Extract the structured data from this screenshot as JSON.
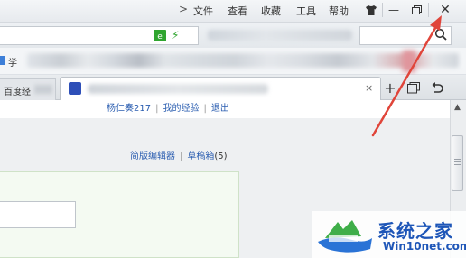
{
  "menubar": {
    "items": [
      "文件",
      "查看",
      "收藏",
      "工具",
      "帮助"
    ],
    "overflow_arrow": ">"
  },
  "window_controls": {
    "skin": "skin-icon",
    "minimize": "—",
    "restore": "restore-icon",
    "close": "✕"
  },
  "address_bar": {
    "icons": [
      "secure-icon",
      "lightning-icon"
    ],
    "search_icon": "search-icon"
  },
  "bookmarks": {
    "first_label": "学"
  },
  "tabs": {
    "previous_tab_label": "百度经",
    "active_tab_close": "×",
    "new_tab": "+",
    "restore_tabs_icon": "restore-tabs-icon",
    "undo_icon": "undo-icon"
  },
  "page": {
    "user_links": [
      "杨仁奏217",
      "我的经验",
      "退出"
    ],
    "editor_links": {
      "simple_editor": "简版编辑器",
      "drafts": "草稿箱",
      "drafts_count": "(5)"
    }
  },
  "watermark": {
    "title": "系统之家",
    "url": "Win10net.com"
  },
  "colors": {
    "annotation_arrow": "#e0453a",
    "link": "#2a5db0",
    "watermark": "#1e56b8"
  }
}
